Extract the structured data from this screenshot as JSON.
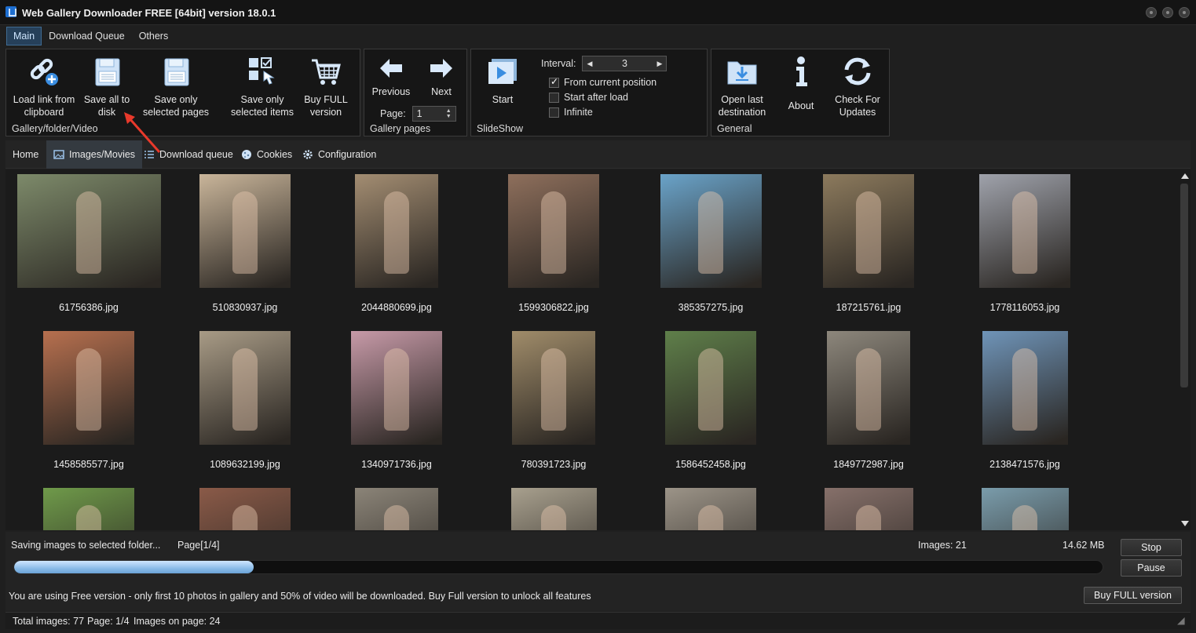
{
  "window": {
    "title": "Web Gallery Downloader FREE [64bit] version 18.0.1"
  },
  "menu_tabs": [
    "Main",
    "Download Queue",
    "Others"
  ],
  "ribbon": {
    "gallery_group": {
      "label": "Gallery/folder/Video",
      "load_link": "Load link from clipboard",
      "save_all": "Save all to disk",
      "save_pages": "Save only selected pages",
      "save_items": "Save only selected items",
      "buy_full": "Buy FULL version"
    },
    "pages_group": {
      "label": "Gallery pages",
      "previous": "Previous",
      "next": "Next",
      "page_label": "Page:",
      "page_value": "1"
    },
    "slideshow_group": {
      "label": "SlideShow",
      "start": "Start",
      "interval_label": "Interval:",
      "interval_value": "3",
      "from_current": "From current position",
      "start_after_load": "Start after load",
      "infinite": "Infinite"
    },
    "general_group": {
      "label": "General",
      "open_last": "Open last destination",
      "about": "About",
      "check_updates": "Check For Updates"
    }
  },
  "sub_tabs": [
    "Home",
    "Images/Movies",
    "Download queue",
    "Cookies",
    "Configuration"
  ],
  "gallery": {
    "items": [
      {
        "name": "61756386.jpg",
        "color": "#7d8a6a"
      },
      {
        "name": "510830937.jpg",
        "color": "#c9b59a"
      },
      {
        "name": "2044880699.jpg",
        "color": "#a38d72"
      },
      {
        "name": "1599306822.jpg",
        "color": "#8e6f5c"
      },
      {
        "name": "385357275.jpg",
        "color": "#6aa3c9"
      },
      {
        "name": "187215761.jpg",
        "color": "#8c7a5d"
      },
      {
        "name": "1778116053.jpg",
        "color": "#9fa2ab"
      },
      {
        "name": "1458585577.jpg",
        "color": "#b7704f"
      },
      {
        "name": "1089632199.jpg",
        "color": "#a89b86"
      },
      {
        "name": "1340971736.jpg",
        "color": "#c79aa8"
      },
      {
        "name": "780391723.jpg",
        "color": "#a08c6a"
      },
      {
        "name": "1586452458.jpg",
        "color": "#5f7f4a"
      },
      {
        "name": "1849772987.jpg",
        "color": "#8d877c"
      },
      {
        "name": "2138471576.jpg",
        "color": "#6f94b8"
      },
      {
        "name": "",
        "color": "#6f9a4a"
      },
      {
        "name": "",
        "color": "#8a5a48"
      },
      {
        "name": "",
        "color": "#8b8478"
      },
      {
        "name": "",
        "color": "#a8a08e"
      },
      {
        "name": "",
        "color": "#9c9488"
      },
      {
        "name": "",
        "color": "#86706a"
      },
      {
        "name": "",
        "color": "#7a9cab"
      }
    ]
  },
  "status": {
    "saving_text": "Saving images to selected folder...",
    "page": "Page[1/4]",
    "images": "Images: 21",
    "size": "14.62 MB",
    "progress": 0.22,
    "stop": "Stop",
    "pause": "Pause",
    "free_notice": "You are using Free version - only first 10 photos in gallery and 50% of video will be downloaded. Buy Full version to unlock all features",
    "buy_full": "Buy FULL version"
  },
  "footer": {
    "total_images": "Total images: 77",
    "page": "Page: 1/4",
    "images_on_page": "Images on page: 24"
  },
  "colors": {
    "accent": "#3f6b92",
    "progress": "#8bbce8",
    "annotation_arrow": "#e8392b"
  }
}
